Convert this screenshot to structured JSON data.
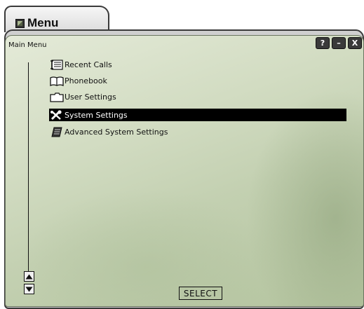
{
  "window": {
    "title": "Menu",
    "icon": "app-icon"
  },
  "panel": {
    "breadcrumb": "Main Menu",
    "controls": {
      "help_label": "?",
      "minimize_label": "–",
      "close_label": "X"
    }
  },
  "menu": {
    "items": [
      {
        "label": "Recent Calls",
        "icon": "call-log-icon",
        "selected": false
      },
      {
        "label": "Phonebook",
        "icon": "book-icon",
        "selected": false
      },
      {
        "label": "User Settings",
        "icon": "folder-icon",
        "selected": false
      },
      {
        "label": "System Settings",
        "icon": "tools-icon",
        "selected": true
      },
      {
        "label": "Advanced System Settings",
        "icon": "notepad-icon",
        "selected": false
      }
    ]
  },
  "footer": {
    "select_label": "SELECT"
  },
  "colors": {
    "panel_green": "#c8d4b6",
    "selection": "#000000",
    "frame": "#3a3a3a"
  }
}
